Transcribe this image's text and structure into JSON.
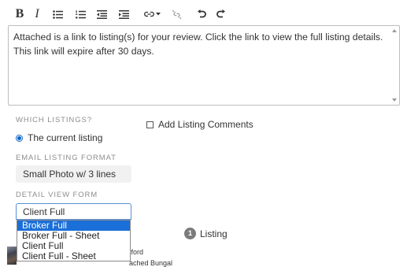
{
  "toolbar": {
    "bold_label": "B",
    "italic_label": "I",
    "buttons": [
      "bold-button",
      "italic-button",
      "bullet-list-button",
      "numbered-list-button",
      "outdent-button",
      "indent-button",
      "link-dropdown-button",
      "unlink-button",
      "undo-button",
      "redo-button"
    ]
  },
  "editor": {
    "text": "Attached is a link to listing(s) for your review. Click the link to view the full listing details. This link will expire after 30 days."
  },
  "which_listings": {
    "label": "WHICH LISTINGS?",
    "option": "The current listing",
    "selected": true
  },
  "add_comments": {
    "label": "Add Listing Comments",
    "checked": false
  },
  "email_format": {
    "label": "EMAIL LISTING FORMAT",
    "value": "Small Photo w/ 3 lines"
  },
  "detail_view": {
    "label": "DETAIL VIEW FORM",
    "value": "Client Full",
    "options": [
      "Broker Full",
      "Broker Full - Sheet",
      "Client Full",
      "Client Full - Sheet"
    ],
    "highlighted_index": 0
  },
  "listing_count": {
    "count": "1",
    "label": "Listing"
  },
  "partial_listing": {
    "line1": "tford",
    "line2": "ached Bungal"
  },
  "colors": {
    "accent": "#1b6fd8",
    "badge": "#7b7b7b",
    "section_label": "#8d8d8d"
  }
}
